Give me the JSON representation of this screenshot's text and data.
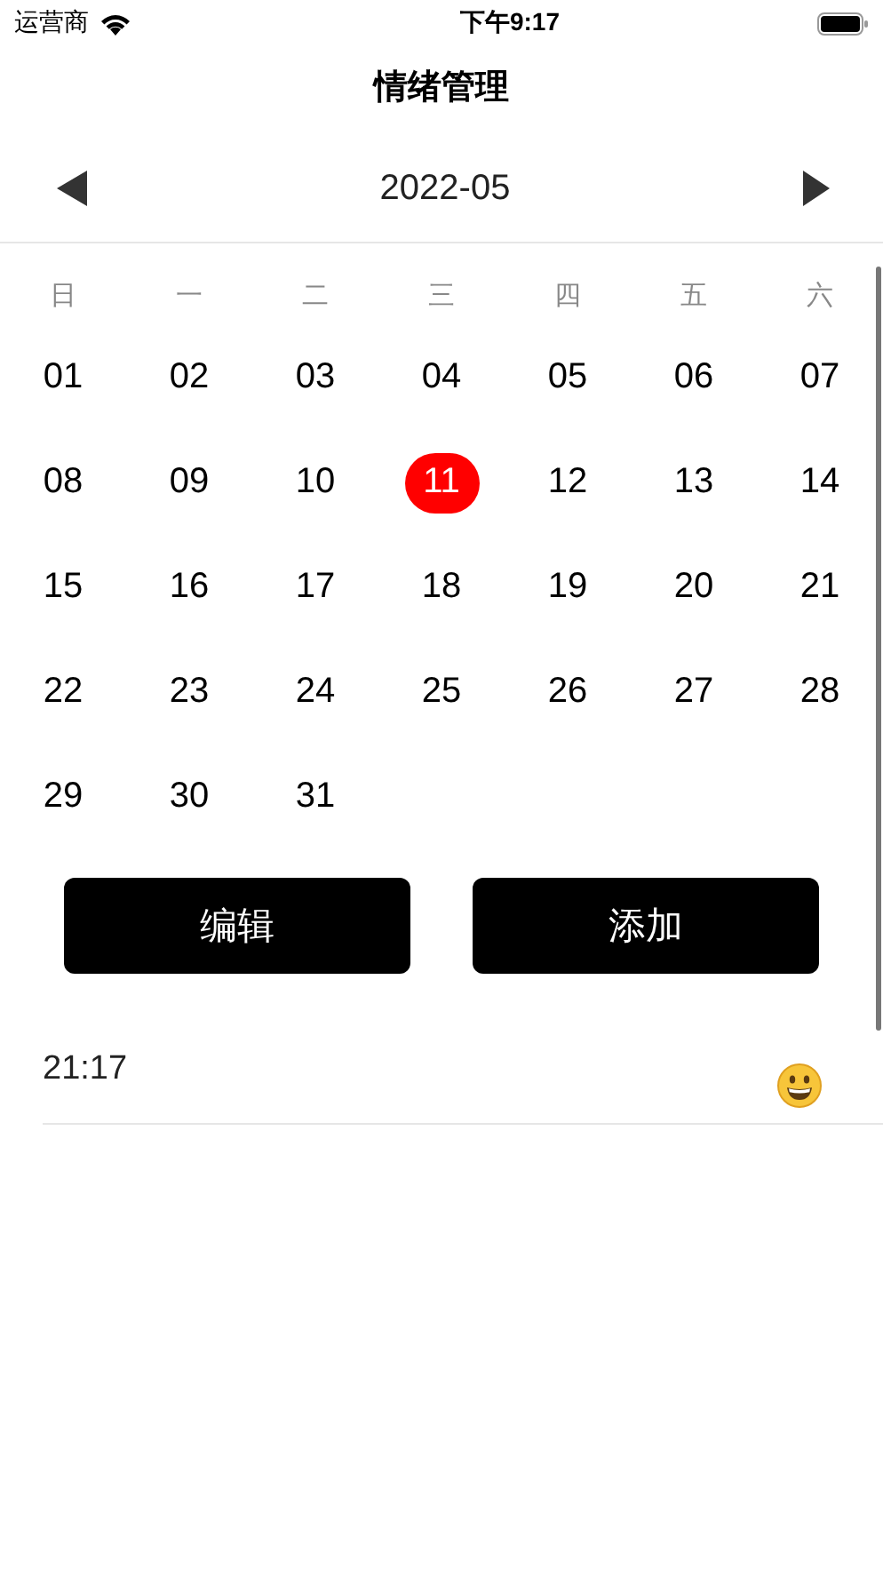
{
  "status_bar": {
    "carrier": "运营商",
    "time": "下午9:17"
  },
  "title": "情绪管理",
  "month_nav": {
    "month": "2022-05"
  },
  "weekdays": [
    "日",
    "一",
    "二",
    "三",
    "四",
    "五",
    "六"
  ],
  "days": [
    {
      "label": "01",
      "selected": false
    },
    {
      "label": "02",
      "selected": false
    },
    {
      "label": "03",
      "selected": false
    },
    {
      "label": "04",
      "selected": false
    },
    {
      "label": "05",
      "selected": false
    },
    {
      "label": "06",
      "selected": false
    },
    {
      "label": "07",
      "selected": false
    },
    {
      "label": "08",
      "selected": false
    },
    {
      "label": "09",
      "selected": false
    },
    {
      "label": "10",
      "selected": false
    },
    {
      "label": "11",
      "selected": true
    },
    {
      "label": "12",
      "selected": false
    },
    {
      "label": "13",
      "selected": false
    },
    {
      "label": "14",
      "selected": false
    },
    {
      "label": "15",
      "selected": false
    },
    {
      "label": "16",
      "selected": false
    },
    {
      "label": "17",
      "selected": false
    },
    {
      "label": "18",
      "selected": false
    },
    {
      "label": "19",
      "selected": false
    },
    {
      "label": "20",
      "selected": false
    },
    {
      "label": "21",
      "selected": false
    },
    {
      "label": "22",
      "selected": false
    },
    {
      "label": "23",
      "selected": false
    },
    {
      "label": "24",
      "selected": false
    },
    {
      "label": "25",
      "selected": false
    },
    {
      "label": "26",
      "selected": false
    },
    {
      "label": "27",
      "selected": false
    },
    {
      "label": "28",
      "selected": false
    },
    {
      "label": "29",
      "selected": false
    },
    {
      "label": "30",
      "selected": false
    },
    {
      "label": "31",
      "selected": false
    }
  ],
  "buttons": [
    "编辑",
    "添加"
  ],
  "entries": [
    {
      "time": "21:17"
    }
  ]
}
